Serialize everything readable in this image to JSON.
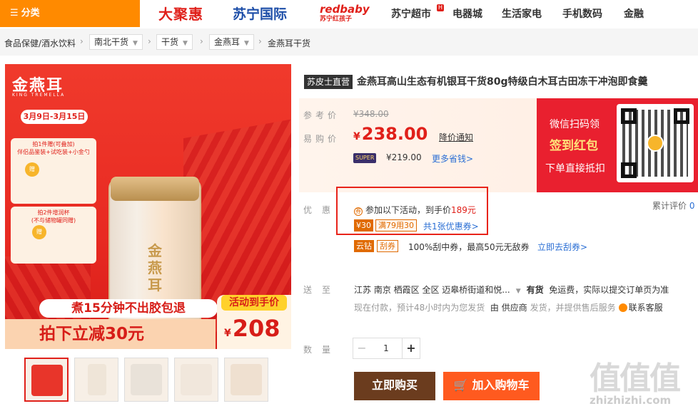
{
  "nav": {
    "category": "分类",
    "items": [
      "大聚惠",
      "苏宁国际",
      "redbaby",
      "苏宁超市",
      "电器城",
      "生活家电",
      "手机数码",
      "金融"
    ],
    "redbaby_sub": "苏宁红孩子",
    "badge": "H"
  },
  "breadcrumb": {
    "root": "食品保健/酒水饮料",
    "level1": "南北干货",
    "level2": "干货",
    "level3": "金燕耳",
    "current": "金燕耳干货"
  },
  "image": {
    "brand": "金燕耳",
    "brand_sub": "KING TREMELLA",
    "date": "3月9日-3月15日",
    "gift1": "拍1件赠(可叠加)\n伴侣品鉴装+试吃装+小金勺",
    "gift2": "拍2件增润杯\n(不与储物罐同赠)",
    "gift_badge": "赠",
    "jar_label": "金燕耳",
    "line1": "煮15分钟不出胶包退",
    "line2": "拍下立减30元",
    "promo_head": "活动到手价",
    "promo_currency": "¥",
    "promo_price": "208"
  },
  "product": {
    "shop_tag": "苏皮士直营",
    "title": "金燕耳高山生态有机银耳干货80g特级白木耳古田冻干冲泡即食羹"
  },
  "price": {
    "ref_label": "参考价",
    "ref_value": "¥348.00",
    "buy_label": "易购价",
    "currency": "¥",
    "value": "238.00",
    "notice": "降价通知",
    "super_badge": "SUPER",
    "super_price": "¥219.00",
    "more": "更多省钱>"
  },
  "wechat": {
    "line1": "微信扫码领",
    "line2": "签到红包",
    "line3": "下单直接抵扣"
  },
  "promo": {
    "label": "优惠",
    "activity_icon": "券",
    "activity_text": "参加以下活动，到手价",
    "activity_price": "189元",
    "coupon_value": "¥30",
    "coupon_rule": "满79用30",
    "coupon_link": "共1张优惠券>",
    "review_label": "累计评价",
    "review_count": "0"
  },
  "yunzuan": {
    "tag1": "云钻",
    "tag2": "刮券",
    "text": "100%刮中券，最高50元无敌券",
    "link": "立即去刮券>"
  },
  "delivery": {
    "label": "送至",
    "address": "江苏 南京 栖霞区 全区 迈皋桥街道和悦...",
    "stock": "有货",
    "shipping": "免运费，实际以提交订单页为准",
    "line2_a": "现在付款，预计48小时内为您发货",
    "line2_b": "由",
    "supplier": "供应商",
    "line2_c": "发货，并提供售后服务",
    "contact": "联系客服"
  },
  "quantity": {
    "label": "数量",
    "minus": "−",
    "value": "1",
    "plus": "+"
  },
  "actions": {
    "buy": "立即购买",
    "cart": "加入购物车"
  },
  "watermark": {
    "chars": "值值值",
    "url": "zhizhizhi.com"
  }
}
